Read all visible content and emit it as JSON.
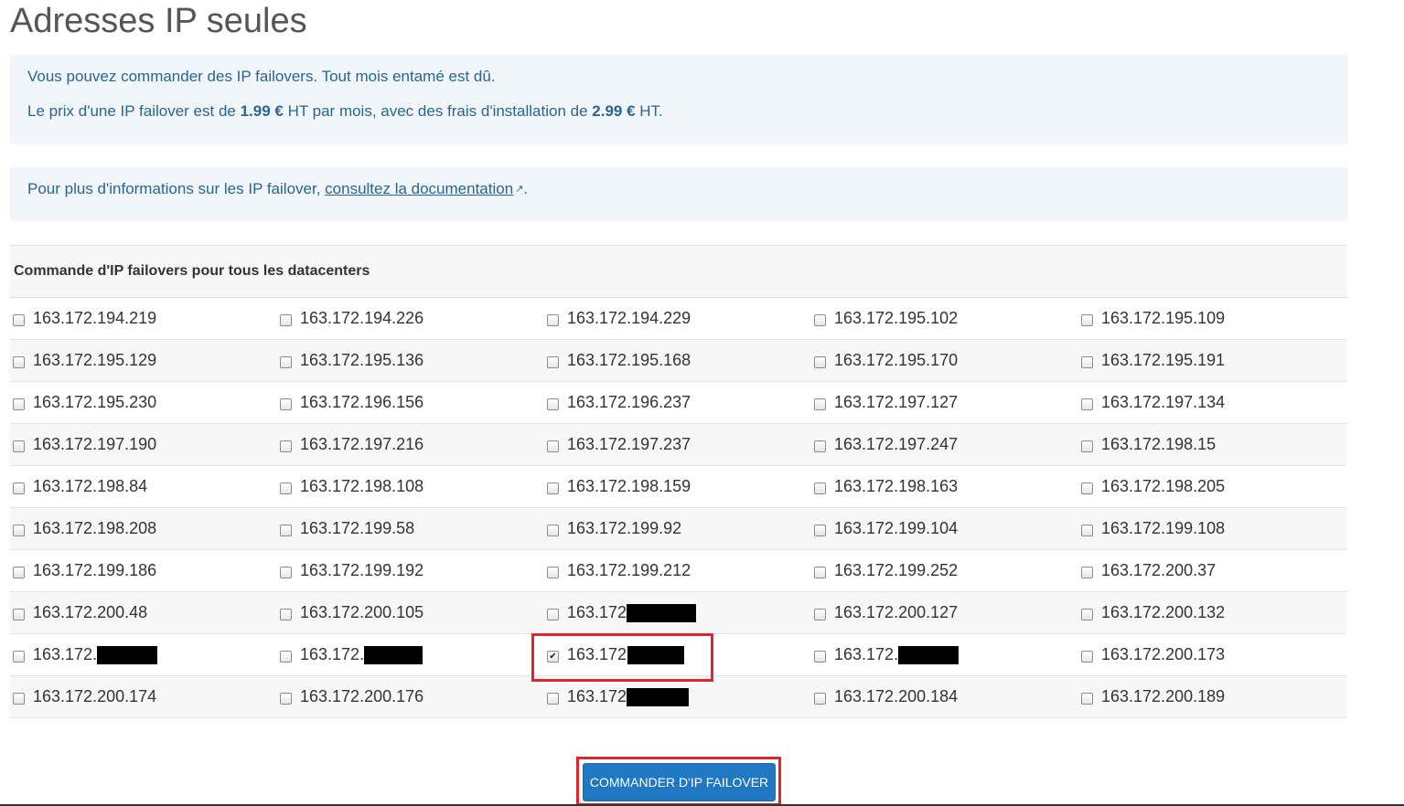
{
  "page": {
    "title": "Adresses IP seules"
  },
  "info": {
    "line1": "Vous pouvez commander des IP failovers. Tout mois entamé est dû.",
    "line2_pre": "Le prix d'une IP failover est de ",
    "price": "1.99 €",
    "line2_mid": " HT par mois, avec des frais d'installation de ",
    "setup_fee": "2.99 €",
    "line2_post": " HT."
  },
  "doc": {
    "pre": "Pour plus d'informations sur les IP failover, ",
    "link": "consultez la documentation",
    "post": "."
  },
  "panel": {
    "heading": "Commande d'IP failovers pour tous les datacenters"
  },
  "ips": [
    [
      "163.172.194.219",
      "163.172.194.226",
      "163.172.194.229",
      "163.172.195.102",
      "163.172.195.109"
    ],
    [
      "163.172.195.129",
      "163.172.195.136",
      "163.172.195.168",
      "163.172.195.170",
      "163.172.195.191"
    ],
    [
      "163.172.195.230",
      "163.172.196.156",
      "163.172.196.237",
      "163.172.197.127",
      "163.172.197.134"
    ],
    [
      "163.172.197.190",
      "163.172.197.216",
      "163.172.197.237",
      "163.172.197.247",
      "163.172.198.15"
    ],
    [
      "163.172.198.84",
      "163.172.198.108",
      "163.172.198.159",
      "163.172.198.163",
      "163.172.198.205"
    ],
    [
      "163.172.198.208",
      "163.172.199.58",
      "163.172.199.92",
      "163.172.199.104",
      "163.172.199.108"
    ],
    [
      "163.172.199.186",
      "163.172.199.192",
      "163.172.199.212",
      "163.172.199.252",
      "163.172.200.37"
    ],
    [
      "163.172.200.48",
      "163.172.200.105",
      "163.172",
      "163.172.200.127",
      "163.172.200.132"
    ],
    [
      "163.172.",
      "163.172.",
      "163.172.",
      "163.172.",
      "163.172.200.173"
    ],
    [
      "163.172.200.174",
      "163.172.200.176",
      "163.172",
      "163.172.200.184",
      "163.172.200.189"
    ]
  ],
  "checked": [
    [
      8,
      2
    ]
  ],
  "redacted": [
    [
      7,
      2
    ],
    [
      8,
      0
    ],
    [
      8,
      1
    ],
    [
      8,
      2
    ],
    [
      8,
      3
    ],
    [
      9,
      2
    ]
  ],
  "button": {
    "label": "COMMANDER D'IP FAILOVER"
  },
  "colors": {
    "accent": "#1f78c1",
    "info_text": "#2a6591",
    "info_bg": "#f1f6fa",
    "highlight": "#e1252f"
  }
}
